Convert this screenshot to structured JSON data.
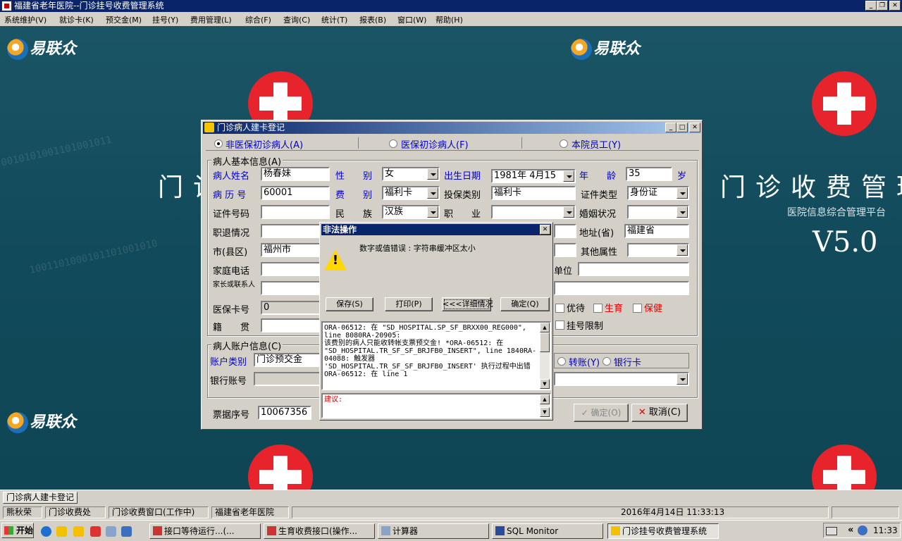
{
  "window": {
    "title": "福建省老年医院--门诊挂号收费管理系统"
  },
  "menu": [
    "系统维护(V)",
    "就诊卡(K)",
    "预交金(M)",
    "挂号(Y)",
    "费用管理(L)",
    "综合(F)",
    "查询(C)",
    "统计(T)",
    "报表(B)",
    "窗口(W)",
    "帮助(H)"
  ],
  "desktop": {
    "logo_text": "易联众",
    "big_title": "门诊收费管理",
    "big_title_left_fragment": "门诊",
    "subtitle": "医院信息综合管理平台",
    "version": "V5.0"
  },
  "dialog": {
    "title": "门诊病人建卡登记",
    "radios": [
      {
        "label": "非医保初诊病人(A)",
        "checked": true
      },
      {
        "label": "医保初诊病人(F)",
        "checked": false
      },
      {
        "label": "本院员工(Y)",
        "checked": false
      }
    ],
    "basic_group": "病人基本信息(A)",
    "labels": {
      "name": "病人姓名",
      "gender": "性　　别",
      "birth": "出生日期",
      "age": "年　　龄",
      "age_unit": "岁",
      "record_no": "病 历 号",
      "fee_type": "费　　别",
      "insure_type": "投保类别",
      "id_type": "证件类型",
      "id_no": "证件号码",
      "ethnic": "民　　族",
      "job": "职　　业",
      "marital": "婚姻状况",
      "retire": "职退情况",
      "province": "地址(省)",
      "city": "市(县区)",
      "other_attr": "其他属性",
      "home_phone": "家庭电话",
      "work_unit": "单位",
      "contact": "家长或联系人",
      "insure_card": "医保卡号",
      "native": "籍　　贯",
      "priority": "优待",
      "birth_care": "生育",
      "health_care": "保健",
      "reg_limit": "挂号限制"
    },
    "values": {
      "name": "杨春妹",
      "gender": "女",
      "birth": "1981年 4月15",
      "age": "35",
      "record_no": "60001",
      "fee_type": "福利卡",
      "insure_type": "福利卡",
      "id_type": "身份证",
      "id_no": "",
      "ethnic": "汉族",
      "job": "",
      "marital": "",
      "retire": "",
      "province": "福建省",
      "city": "福州市",
      "other_attr": "",
      "home_phone": "",
      "work_unit": "",
      "contact": "",
      "insure_card": "0",
      "native": ""
    },
    "account_group": "病人账户信息(C)",
    "account_type_label": "账户类别",
    "account_type_value": "门诊预交金",
    "transfer_label": "转账(Y)",
    "bank_card_label": "银行卡",
    "bank_acct_label": "银行账号",
    "bank_acct_value": "",
    "receipt_label": "票据序号",
    "receipt_value": "10067356",
    "ok_button": "确定(O)",
    "cancel_button": "取消(C)"
  },
  "error_dialog": {
    "title": "非法操作",
    "message": "数字或值错误 :  字符串缓冲区太小",
    "buttons": [
      "保存(S)",
      "打印(P)",
      "<<<详细情况",
      "确定(Q)"
    ],
    "detail_lines": [
      "ORA-06512: 在 \"SD_HOSPITAL.SP_SF_BRXX00_REG000\",",
      "line 8080RA-20905:",
      "该费别的病人只能收转帐支票预交金! *ORA-06512: 在",
      "\"SD_HOSPITAL.TR_SF_SF_BRJFB0_INSERT\", line 1840RA-",
      "04088: 触发器",
      "'SD_HOSPITAL.TR_SF_SF_BRJFB0_INSERT' 执行过程中出错",
      "ORA-06512: 在 line 1"
    ],
    "suggestion_label": "建议:"
  },
  "mdi_tab": "门诊病人建卡登记",
  "status": {
    "user": "熊秋荣",
    "dept": "门诊收费处",
    "window": "门诊收费窗口(工作中)",
    "hospital": "福建省老年医院",
    "datetime": "2016年4月14日  11:33:13"
  },
  "taskbar": {
    "start": "开始",
    "tasks": [
      {
        "label": "接口等待运行...(...",
        "active": false
      },
      {
        "label": "生育收费接口(操作...",
        "active": false
      },
      {
        "label": "计算器",
        "active": false
      },
      {
        "label": "SQL Monitor",
        "active": false
      },
      {
        "label": "门诊挂号收费管理系统",
        "active": true
      }
    ],
    "clock": "11:33",
    "chevron": "«"
  }
}
